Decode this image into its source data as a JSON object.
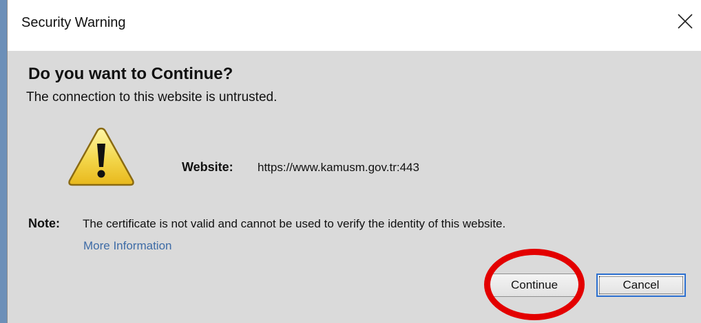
{
  "window": {
    "title": "Security Warning",
    "close_icon": "close-icon"
  },
  "main": {
    "heading": "Do you want to Continue?",
    "subheading": "The connection to this website is untrusted.",
    "icon": "warning-icon",
    "website_label": "Website:",
    "website_value": "https://www.kamusm.gov.tr:443",
    "note_label": "Note:",
    "note_text": "The certificate is not valid and cannot be used to verify the identity of this website.",
    "more_info_link": "More Information"
  },
  "buttons": {
    "continue_label": "Continue",
    "cancel_label": "Cancel"
  },
  "colors": {
    "dialog_background": "#dadada",
    "title_background": "#ffffff",
    "link": "#3d6ba6",
    "annotation_ring": "#e30000",
    "default_button_border": "#2b6fcf"
  }
}
